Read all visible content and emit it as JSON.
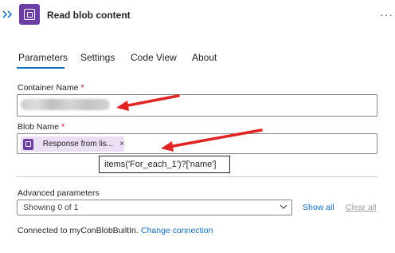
{
  "header": {
    "title": "Read blob content",
    "more_glyph": "···",
    "icon": "blob-storage-icon",
    "accent_color": "#6b3fa0"
  },
  "tabs": [
    {
      "label": "Parameters",
      "selected": true
    },
    {
      "label": "Settings"
    },
    {
      "label": "Code View"
    },
    {
      "label": "About"
    }
  ],
  "fields": {
    "container": {
      "label": "Container Name",
      "required_mark": "*"
    },
    "blob": {
      "label": "Blob Name",
      "required_mark": "*",
      "token_text": "Response from lis...",
      "token_close": "×",
      "tooltip": "items('For_each_1')?['name']"
    }
  },
  "advanced": {
    "label": "Advanced parameters",
    "select_value": "Showing 0 of 1",
    "show_all": "Show all",
    "clear_all": "Clear all"
  },
  "connection": {
    "text": "Connected to myConBlobBuiltIn.",
    "change_link": "Change connection"
  },
  "colors": {
    "link": "#0f6cbd",
    "annotation_arrow": "#e02424"
  }
}
